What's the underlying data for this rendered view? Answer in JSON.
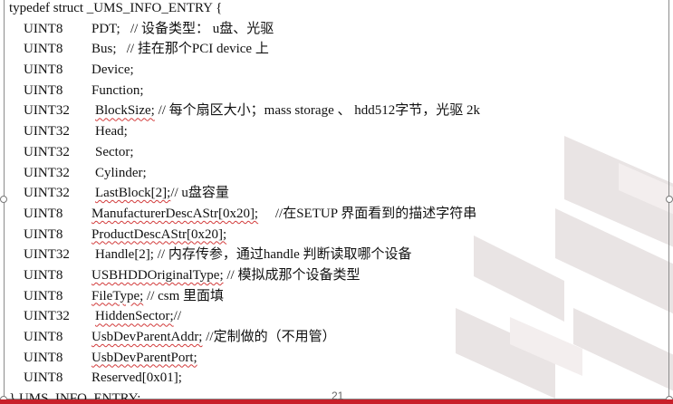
{
  "code": {
    "header": "typedef struct _UMS_INFO_ENTRY {",
    "footer": "} UMS_INFO_ENTRY;",
    "fields": [
      {
        "type": "UINT8",
        "name": "PDT;",
        "comment": "// 设备类型： u盘、光驱"
      },
      {
        "type": "UINT8",
        "name": "Bus;",
        "comment": "//  挂在那个PCI device 上"
      },
      {
        "type": "UINT8",
        "name": "Device;",
        "comment": ""
      },
      {
        "type": "UINT8",
        "name": "Function;",
        "comment": ""
      },
      {
        "type": "UINT32",
        "name": "BlockSize;",
        "comment": "// 每个扇区大小；mass storage 、  hdd512字节，光驱 2k"
      },
      {
        "type": "UINT32",
        "name": "Head;",
        "comment": ""
      },
      {
        "type": "UINT32",
        "name": "Sector;",
        "comment": ""
      },
      {
        "type": "UINT32",
        "name": "Cylinder;",
        "comment": ""
      },
      {
        "type": "UINT32",
        "name": "LastBlock[2];",
        "comment": "// u盘容量"
      },
      {
        "type": "UINT8",
        "name": "ManufacturerDescAStr[0x20];",
        "comment": "//在SETUP 界面看到的描述字符串"
      },
      {
        "type": "UINT8",
        "name": "ProductDescAStr[0x20];",
        "comment": ""
      },
      {
        "type": "UINT32",
        "name": "Handle[2];",
        "comment": "// 内存传参，通过handle 判断读取哪个设备"
      },
      {
        "type": "UINT8",
        "name": "USBHDDOriginalType;",
        "comment": "// 模拟成那个设备类型"
      },
      {
        "type": "UINT8",
        "name": "FileType;",
        "comment": "// csm 里面填"
      },
      {
        "type": "UINT32",
        "name": "HiddenSector;",
        "comment": "//"
      },
      {
        "type": "UINT8",
        "name": "UsbDevParentAddr;",
        "comment": "//定制做的（不用管）"
      },
      {
        "type": "UINT8",
        "name": "UsbDevParentPort;",
        "comment": ""
      },
      {
        "type": "UINT8",
        "name": "Reserved[0x01];",
        "comment": ""
      }
    ]
  },
  "page_number": "21",
  "colors": {
    "accent": "#c8202a",
    "squiggle": "#d23b3b",
    "text": "#111111"
  }
}
